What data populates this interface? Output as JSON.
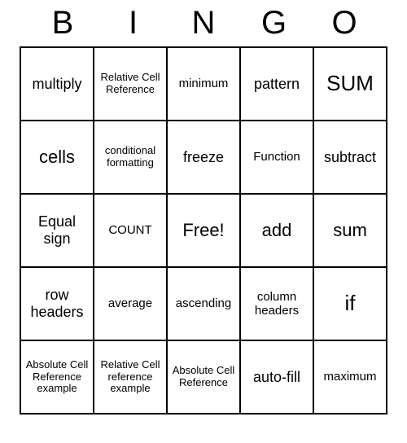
{
  "header": [
    "B",
    "I",
    "N",
    "G",
    "O"
  ],
  "cells": [
    [
      {
        "text": "multiply",
        "size": ""
      },
      {
        "text": "Relative Cell Reference",
        "size": "sm"
      },
      {
        "text": "minimum",
        "size": "md"
      },
      {
        "text": "pattern",
        "size": ""
      },
      {
        "text": "SUM",
        "size": "xl"
      }
    ],
    [
      {
        "text": "cells",
        "size": "lg"
      },
      {
        "text": "conditional formatting",
        "size": "sm"
      },
      {
        "text": "freeze",
        "size": ""
      },
      {
        "text": "Function",
        "size": "md"
      },
      {
        "text": "subtract",
        "size": ""
      }
    ],
    [
      {
        "text": "Equal sign",
        "size": ""
      },
      {
        "text": "COUNT",
        "size": "md"
      },
      {
        "text": "Free!",
        "size": "lg"
      },
      {
        "text": "add",
        "size": "lg"
      },
      {
        "text": "sum",
        "size": "lg"
      }
    ],
    [
      {
        "text": "row headers",
        "size": ""
      },
      {
        "text": "average",
        "size": "md"
      },
      {
        "text": "ascending",
        "size": "md"
      },
      {
        "text": "column headers",
        "size": "md"
      },
      {
        "text": "if",
        "size": "xl"
      }
    ],
    [
      {
        "text": "Absolute Cell Reference example",
        "size": "sm"
      },
      {
        "text": "Relative Cell reference example",
        "size": "sm"
      },
      {
        "text": "Absolute Cell Reference",
        "size": "sm"
      },
      {
        "text": "auto-fill",
        "size": ""
      },
      {
        "text": "maximum",
        "size": "md"
      }
    ]
  ]
}
